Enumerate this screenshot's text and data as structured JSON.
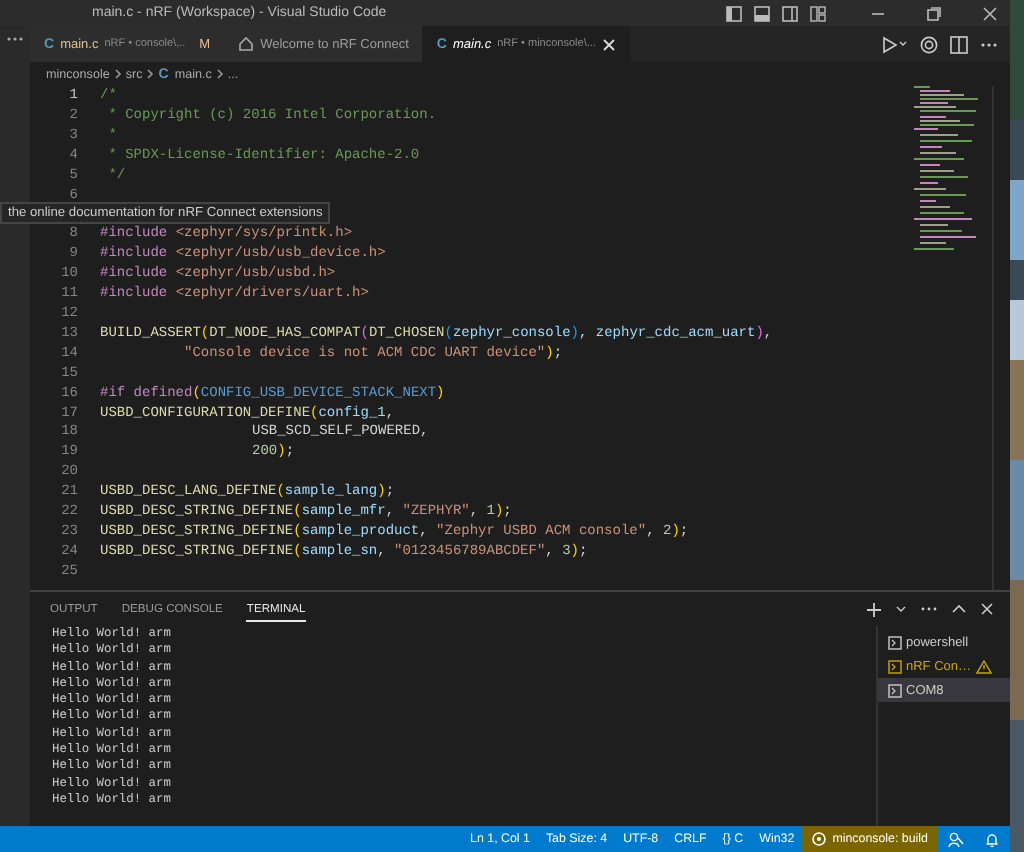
{
  "window": {
    "title": "main.c - nRF (Workspace) - Visual Studio Code"
  },
  "tabs": [
    {
      "kind": "file",
      "icon_text": "C",
      "label": "main.c",
      "detail": "nRF • console\\,..",
      "badge": "M",
      "selected": false
    },
    {
      "kind": "page",
      "label": "Welcome to nRF Connect",
      "selected": false
    },
    {
      "kind": "file",
      "icon_text": "C",
      "label": "main.c",
      "detail": "nRF • minconsole\\...",
      "selected": true
    }
  ],
  "breadcrumb": [
    {
      "text": "minconsole"
    },
    {
      "text": "src"
    },
    {
      "text": "main.c",
      "icon_text": "C"
    },
    {
      "text": "..."
    }
  ],
  "tooltip": "the online documentation for nRF Connect extensions",
  "editor": {
    "lines": [
      {
        "number": "1",
        "tokens": [
          {
            "kind": "comment",
            "text": "/*"
          }
        ]
      },
      {
        "number": "2",
        "tokens": [
          {
            "kind": "comment",
            "text": " * Copyright (c) 2016 Intel Corporation."
          }
        ]
      },
      {
        "number": "3",
        "tokens": [
          {
            "kind": "comment",
            "text": " *"
          }
        ]
      },
      {
        "number": "4",
        "tokens": [
          {
            "kind": "comment",
            "text": " * SPDX-License-Identifier: Apache-2.0"
          }
        ]
      },
      {
        "number": "5",
        "tokens": [
          {
            "kind": "comment",
            "text": " */"
          }
        ]
      },
      {
        "number": "6"
      },
      {
        "kind": "hidden"
      },
      {
        "number": "8",
        "tokens": [
          {
            "kind": "keyword",
            "text": "#include"
          },
          {
            "kind": "string",
            "text": "<zephyr/sys/printk.h>"
          }
        ]
      },
      {
        "number": "9",
        "tokens": [
          {
            "kind": "keyword",
            "text": "#include"
          },
          {
            "kind": "string",
            "text": "<zephyr/usb/usb_device.h>"
          }
        ]
      },
      {
        "number": "10",
        "tokens": [
          {
            "kind": "keyword",
            "text": "#include"
          },
          {
            "kind": "string",
            "text": "<zephyr/usb/usbd.h>"
          }
        ]
      },
      {
        "number": "11",
        "tokens": [
          {
            "kind": "keyword",
            "text": "#include"
          },
          {
            "kind": "string",
            "text": "<zephyr/drivers/uart.h>"
          }
        ]
      },
      {
        "number": "12"
      },
      {
        "number": "13",
        "tokens": [
          {
            "kind": "function",
            "text": "BUILD_ASSERT"
          },
          {
            "kind": "paren1",
            "text": "("
          },
          {
            "kind": "function",
            "text": "DT_NODE_HAS_COMPAT"
          },
          {
            "kind": "paren2",
            "text": "("
          },
          {
            "kind": "function",
            "text": "DT_CHOSEN"
          },
          {
            "kind": "paren3",
            "text": "("
          },
          {
            "kind": "variable",
            "text": "zephyr_console"
          },
          {
            "kind": "paren3",
            "text": ")"
          },
          {
            "kind": "plain",
            "text": ", "
          },
          {
            "kind": "variable",
            "text": "zephyr_cdc_acm_uart"
          },
          {
            "kind": "paren2",
            "text": ")"
          },
          {
            "kind": "plain",
            "text": ","
          }
        ]
      },
      {
        "number": "14",
        "kind": "continuation",
        "tokens": [
          {
            "kind": "string",
            "text": "\"Console device is not ACM CDC UART device\""
          },
          {
            "kind": "paren1",
            "text": ")"
          },
          {
            "kind": "plain",
            "text": ";"
          }
        ]
      },
      {
        "number": "15"
      },
      {
        "number": "16",
        "tokens": [
          {
            "kind": "keyword",
            "text": "#if defined"
          },
          {
            "kind": "paren1",
            "text": "("
          },
          {
            "kind": "macro",
            "text": "CONFIG_USB_DEVICE_STACK_NEXT"
          },
          {
            "kind": "paren1",
            "text": ")"
          }
        ]
      },
      {
        "number": "17",
        "tokens": [
          {
            "kind": "function",
            "text": "USBD_CONFIGURATION_DEFINE"
          },
          {
            "kind": "paren1",
            "text": "("
          },
          {
            "kind": "variable",
            "text": "config_1"
          },
          {
            "kind": "plain",
            "text": ","
          }
        ]
      },
      {
        "number": "18",
        "kind": "argument",
        "tokens": [
          {
            "kind": "plain",
            "text": "USB_SCD_SELF_POWERED,"
          }
        ]
      },
      {
        "number": "19",
        "kind": "argument",
        "tokens": [
          {
            "kind": "number",
            "text": "200"
          },
          {
            "kind": "paren1",
            "text": ")"
          },
          {
            "kind": "plain",
            "text": ";"
          }
        ]
      },
      {
        "number": "20"
      },
      {
        "number": "21",
        "tokens": [
          {
            "kind": "function",
            "text": "USBD_DESC_LANG_DEFINE"
          },
          {
            "kind": "paren1",
            "text": "("
          },
          {
            "kind": "variable",
            "text": "sample_lang"
          },
          {
            "kind": "paren1",
            "text": ")"
          },
          {
            "kind": "plain",
            "text": ";"
          }
        ]
      },
      {
        "number": "22",
        "tokens": [
          {
            "kind": "function",
            "text": "USBD_DESC_STRING_DEFINE"
          },
          {
            "kind": "paren1",
            "text": "("
          },
          {
            "kind": "variable",
            "text": "sample_mfr"
          },
          {
            "kind": "plain",
            "text": ", "
          },
          {
            "kind": "string",
            "text": "\"ZEPHYR\""
          },
          {
            "kind": "plain",
            "text": ", "
          },
          {
            "kind": "number",
            "text": "1"
          },
          {
            "kind": "paren1",
            "text": ")"
          },
          {
            "kind": "plain",
            "text": ";"
          }
        ]
      },
      {
        "number": "23",
        "tokens": [
          {
            "kind": "function",
            "text": "USBD_DESC_STRING_DEFINE"
          },
          {
            "kind": "paren1",
            "text": "("
          },
          {
            "kind": "variable",
            "text": "sample_product"
          },
          {
            "kind": "plain",
            "text": ", "
          },
          {
            "kind": "string",
            "text": "\"Zephyr USBD ACM console\""
          },
          {
            "kind": "plain",
            "text": ", "
          },
          {
            "kind": "number",
            "text": "2"
          },
          {
            "kind": "paren1",
            "text": ")"
          },
          {
            "kind": "plain",
            "text": ";"
          }
        ]
      },
      {
        "number": "24",
        "tokens": [
          {
            "kind": "function",
            "text": "USBD_DESC_STRING_DEFINE"
          },
          {
            "kind": "paren1",
            "text": "("
          },
          {
            "kind": "variable",
            "text": "sample_sn"
          },
          {
            "kind": "plain",
            "text": ", "
          },
          {
            "kind": "string",
            "text": "\"0123456789ABCDEF\""
          },
          {
            "kind": "plain",
            "text": ", "
          },
          {
            "kind": "number",
            "text": "3"
          },
          {
            "kind": "paren1",
            "text": ")"
          },
          {
            "kind": "plain",
            "text": ";"
          }
        ]
      },
      {
        "number": "25"
      }
    ]
  },
  "panel": {
    "tabs": [
      {
        "label": "OUTPUT",
        "selected": false
      },
      {
        "label": "DEBUG CONSOLE",
        "selected": false
      },
      {
        "label": "TERMINAL",
        "selected": true
      }
    ],
    "terminal_lines": [
      "Hello World! arm",
      "Hello World! arm",
      "Hello World! arm",
      "Hello World! arm",
      "Hello World! arm",
      "Hello World! arm",
      "Hello World! arm",
      "Hello World! arm",
      "Hello World! arm",
      "Hello World! arm",
      "Hello World! arm"
    ],
    "terminals": [
      {
        "name": "powershell",
        "warning": false,
        "selected": false
      },
      {
        "name": "nRF Con…",
        "warning": true,
        "selected": false
      },
      {
        "name": "COM8",
        "warning": false,
        "selected": true
      }
    ]
  },
  "status_bar": {
    "items": [
      {
        "kind": "text",
        "text": "Ln 1, Col 1"
      },
      {
        "kind": "text",
        "text": "Tab Size: 4"
      },
      {
        "kind": "text",
        "text": "UTF-8"
      },
      {
        "kind": "text",
        "text": "CRLF"
      },
      {
        "kind": "lang",
        "icon_text": "{}",
        "text": "C"
      },
      {
        "kind": "text",
        "text": "Win32"
      },
      {
        "kind": "task",
        "text": "minconsole: build"
      }
    ]
  }
}
